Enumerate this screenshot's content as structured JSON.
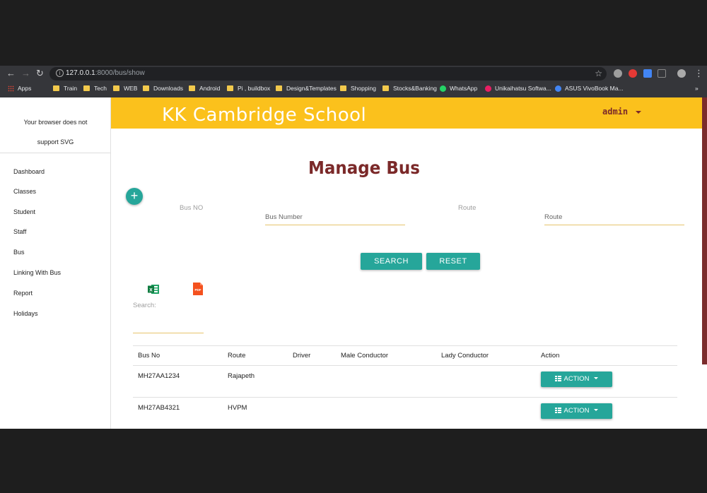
{
  "browser": {
    "url_host": "127.0.0.1",
    "url_path": ":8000/bus/show",
    "bookmarks": [
      {
        "label": "Apps",
        "icon": "apps-grid-icon"
      },
      {
        "label": "Train",
        "icon": "folder-icon"
      },
      {
        "label": "Tech",
        "icon": "folder-icon"
      },
      {
        "label": "WEB",
        "icon": "folder-icon"
      },
      {
        "label": "Downloads",
        "icon": "folder-icon"
      },
      {
        "label": "Android",
        "icon": "folder-icon"
      },
      {
        "label": "Pi , buildbox",
        "icon": "folder-icon"
      },
      {
        "label": "Design&Templates",
        "icon": "folder-icon"
      },
      {
        "label": "Shopping",
        "icon": "folder-icon"
      },
      {
        "label": "Stocks&Banking",
        "icon": "folder-icon"
      },
      {
        "label": "WhatsApp",
        "icon": "whatsapp-icon"
      },
      {
        "label": "Unikaihatsu Softwa...",
        "icon": "unikaihatsu-icon"
      },
      {
        "label": "ASUS VivoBook Ma...",
        "icon": "asus-icon"
      }
    ],
    "more_bookmarks": "»"
  },
  "sidebar": {
    "svg_note_line1": "Your browser does not",
    "svg_note_line2": "support SVG",
    "items": [
      {
        "label": "Dashboard"
      },
      {
        "label": "Classes"
      },
      {
        "label": "Student"
      },
      {
        "label": "Staff"
      },
      {
        "label": "Bus"
      },
      {
        "label": "Linking With Bus"
      },
      {
        "label": "Report"
      },
      {
        "label": "Holidays"
      }
    ]
  },
  "header": {
    "school_name": "KK Cambridge School",
    "user": "admin",
    "accent_color": "#fbc11c",
    "brand_color": "#7b2929"
  },
  "main": {
    "title": "Manage Bus",
    "add_icon": "plus-icon",
    "filters": {
      "bus_no_label": "Bus NO",
      "bus_no_placeholder": "Bus Number",
      "route_label": "Route",
      "route_placeholder": "Route"
    },
    "search_button": "SEARCH",
    "reset_button": "RESET",
    "button_color": "#26a69a",
    "export_icons": [
      "excel-icon",
      "pdf-icon"
    ],
    "search_label": "Search:",
    "table": {
      "headers": [
        "Bus No",
        "Route",
        "Driver",
        "Male Conductor",
        "Lady Conductor",
        "Action"
      ],
      "rows": [
        {
          "bus_no": "MH27AA1234",
          "route": "Rajapeth",
          "driver": "",
          "male_conductor": "",
          "lady_conductor": "",
          "action": "ACTION"
        },
        {
          "bus_no": "MH27AB4321",
          "route": "HVPM",
          "driver": "",
          "male_conductor": "",
          "lady_conductor": "",
          "action": "ACTION"
        }
      ]
    }
  }
}
